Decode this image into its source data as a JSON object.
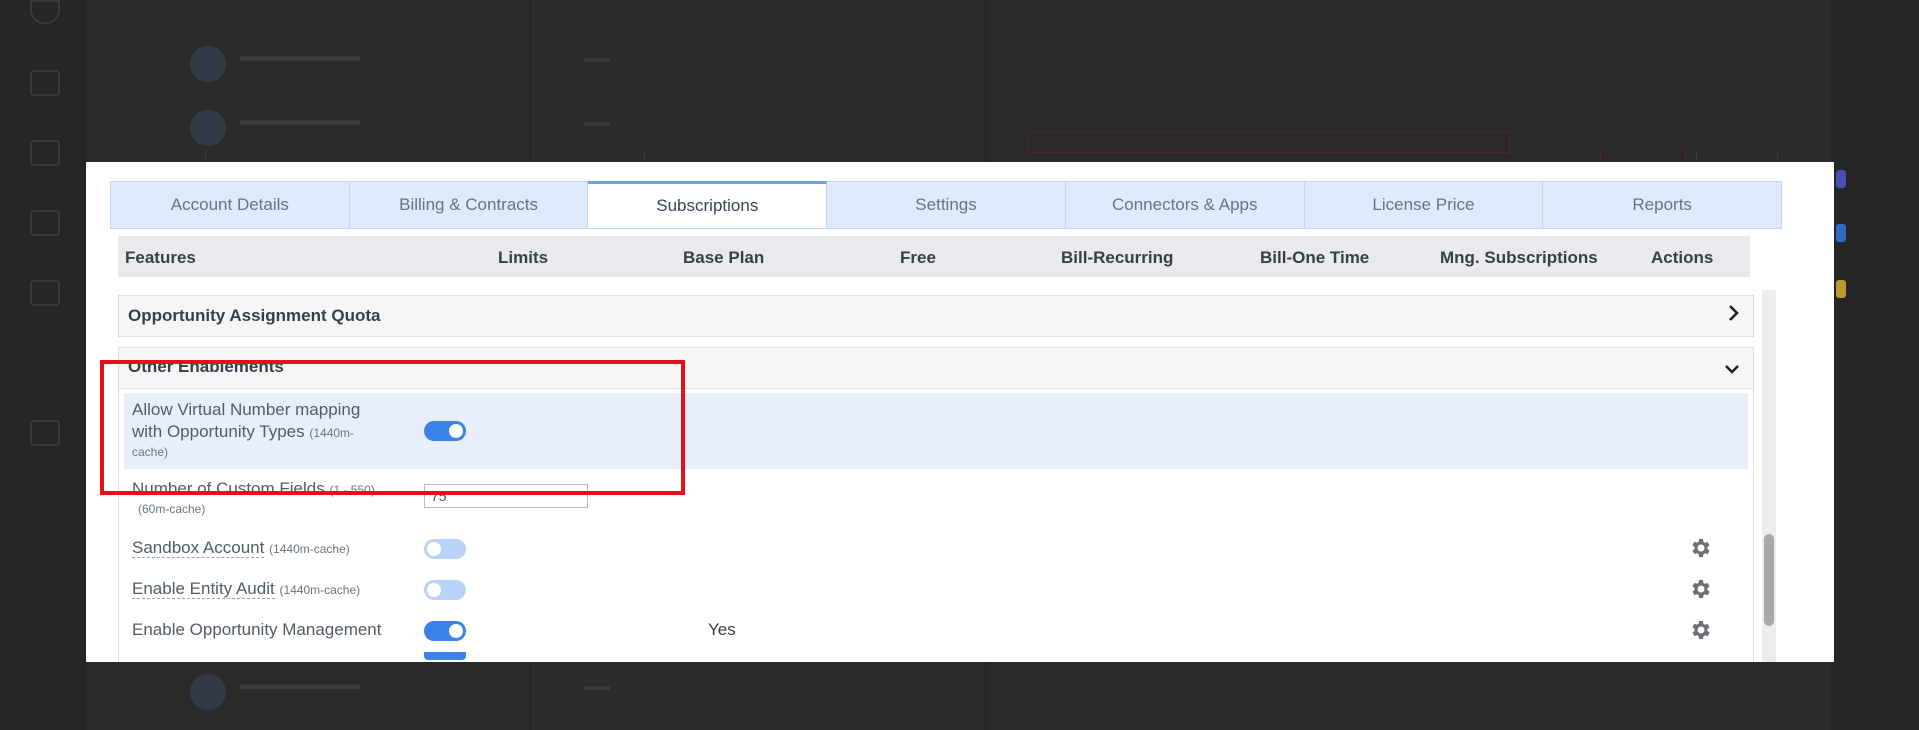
{
  "tabs": [
    {
      "label": "Account Details"
    },
    {
      "label": "Billing & Contracts"
    },
    {
      "label": "Subscriptions",
      "active": true
    },
    {
      "label": "Settings"
    },
    {
      "label": "Connectors & Apps"
    },
    {
      "label": "License Price"
    },
    {
      "label": "Reports"
    }
  ],
  "columns": {
    "features": "Features",
    "limits": "Limits",
    "base_plan": "Base Plan",
    "free": "Free",
    "bill_recurring": "Bill-Recurring",
    "bill_one_time": "Bill-One Time",
    "mng_subscriptions": "Mng. Subscriptions",
    "actions": "Actions"
  },
  "sections": {
    "quota": {
      "title": "Opportunity Assignment Quota",
      "expanded": false
    },
    "other": {
      "title": "Other Enablements",
      "expanded": true
    }
  },
  "rows": {
    "virtual_number": {
      "label_line1": "Allow Virtual Number mapping",
      "label_line2": "with Opportunity Types",
      "cache_a": "(1440m-",
      "cache_b": "cache)",
      "toggle": "on"
    },
    "custom_fields": {
      "label": "Number of Custom Fields",
      "range": "(1 - 550)",
      "cache": "(60m-cache)",
      "value": "75"
    },
    "sandbox": {
      "label": "Sandbox Account",
      "cache": "(1440m-cache)",
      "toggle": "off"
    },
    "entity_audit": {
      "label": "Enable Entity Audit",
      "cache": "(1440m-cache)",
      "toggle": "off"
    },
    "opportunity_mgmt": {
      "label": "Enable Opportunity Management",
      "toggle": "on",
      "base_plan": "Yes"
    }
  },
  "icons": {
    "gear": "gear-icon",
    "chevron_right": "chevron-right-icon",
    "chevron_down": "chevron-down-icon"
  },
  "colors": {
    "accent": "#3b82e6",
    "highlight_box": "#e3101a",
    "tab_bar": "#ddebfb"
  }
}
